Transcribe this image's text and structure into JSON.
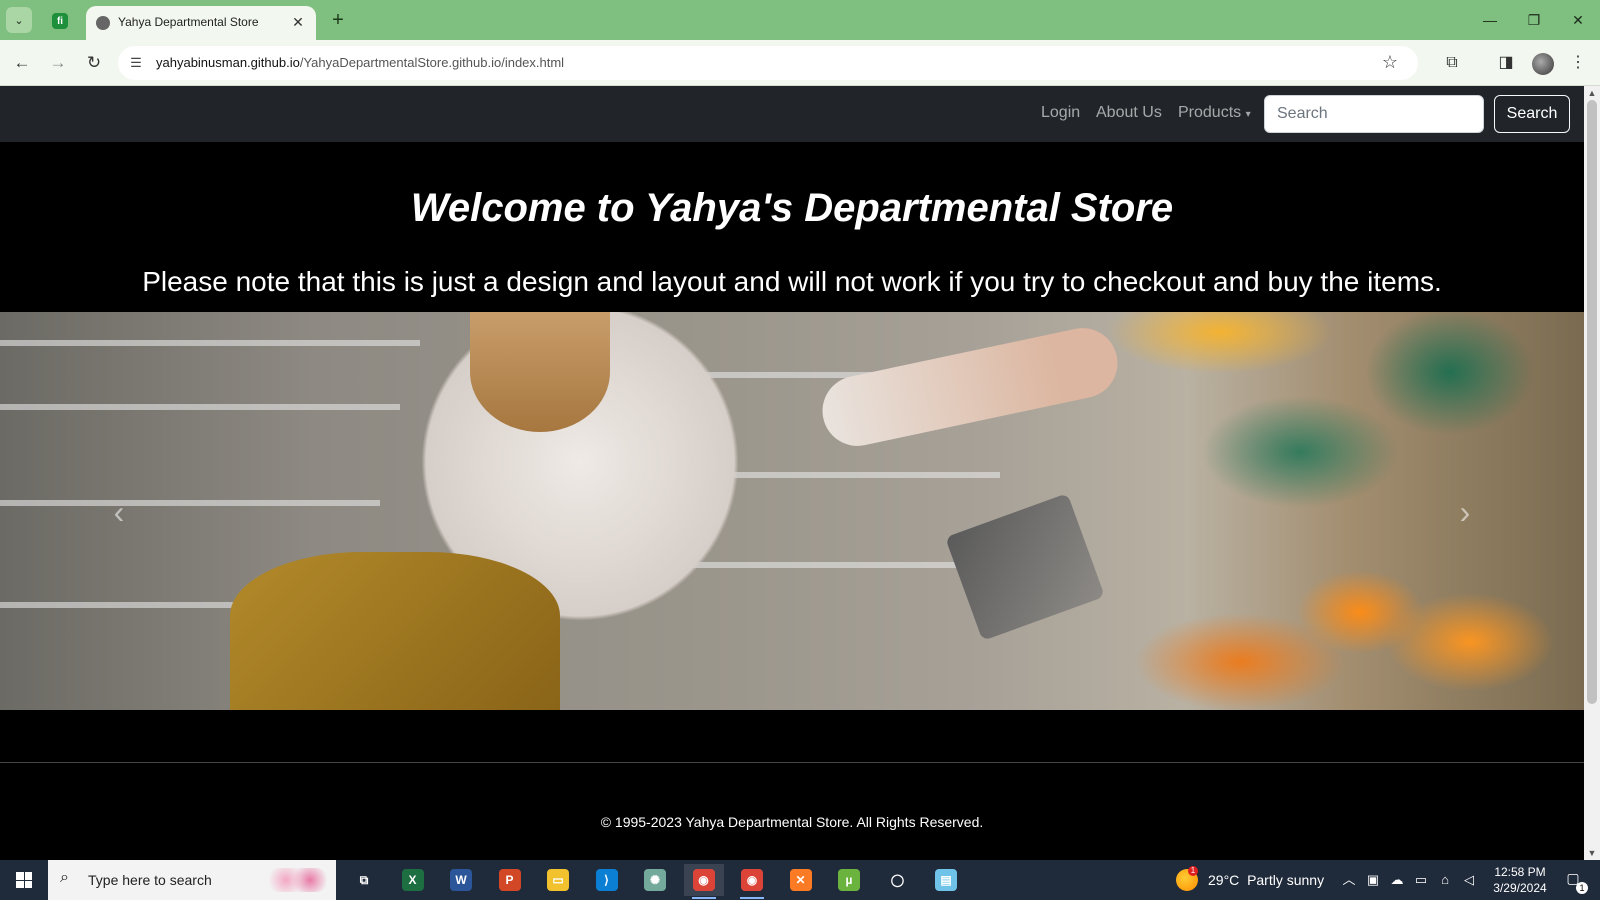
{
  "browser": {
    "tab_title": "Yahya Departmental Store",
    "url_domain": "yahyabinusman.github.io",
    "url_path": "/YahyaDepartmentalStore.github.io/index.html",
    "pinned_tab_icon": "fi",
    "new_tab_label": "+"
  },
  "site": {
    "nav": {
      "login": "Login",
      "about": "About Us",
      "products": "Products",
      "search_placeholder": "Search",
      "search_button": "Search"
    },
    "welcome": "Welcome to Yahya's Departmental Store",
    "note": "Please note that this is just a design and layout and will not work if you try to checkout and buy the items.",
    "carousel": {
      "image_alt": "",
      "prev_icon": "‹",
      "next_icon": "›"
    },
    "footer": "© 1995-2023 Yahya Departmental Store. All Rights Reserved."
  },
  "taskbar": {
    "search_placeholder": "Type here to search",
    "weather_temp": "29°C",
    "weather_desc": "Partly sunny",
    "weather_badge": "1",
    "time": "12:58 PM",
    "date": "3/29/2024",
    "notification_count": "1",
    "apps": [
      {
        "name": "task-view",
        "color": "transparent",
        "glyph": "⧉"
      },
      {
        "name": "excel",
        "color": "#1d6f42",
        "glyph": "X"
      },
      {
        "name": "word",
        "color": "#2b579a",
        "glyph": "W"
      },
      {
        "name": "powerpoint",
        "color": "#d24726",
        "glyph": "P"
      },
      {
        "name": "file-explorer",
        "color": "#f2c12e",
        "glyph": "▭"
      },
      {
        "name": "vscode",
        "color": "#0a7fd4",
        "glyph": "⟩"
      },
      {
        "name": "chatgpt",
        "color": "#74aa9c",
        "glyph": "✺"
      },
      {
        "name": "chrome-active",
        "color": "#db4437",
        "glyph": "◉"
      },
      {
        "name": "chrome",
        "color": "#db4437",
        "glyph": "◉"
      },
      {
        "name": "xampp",
        "color": "#fb7a24",
        "glyph": "✕"
      },
      {
        "name": "utorrent",
        "color": "#6bb33f",
        "glyph": "µ"
      },
      {
        "name": "obs",
        "color": "transparent",
        "glyph": "◯"
      },
      {
        "name": "notepad",
        "color": "#6fc3e8",
        "glyph": "▤"
      }
    ]
  }
}
